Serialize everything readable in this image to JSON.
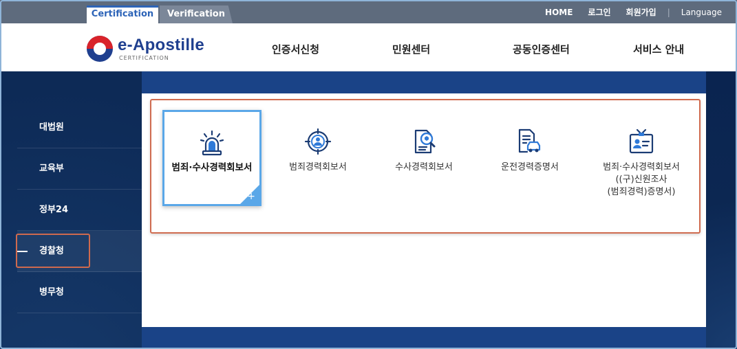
{
  "tabs": {
    "certification": "Certification",
    "verification": "Verification"
  },
  "top_links": {
    "home": "HOME",
    "login": "로그인",
    "signup": "회원가입",
    "separator": "|",
    "language": "Language"
  },
  "logo": {
    "name": "e-Apostille",
    "sub": "CERTIFICATION"
  },
  "nav": [
    {
      "label": "인증서신청"
    },
    {
      "label": "민원센터"
    },
    {
      "label": "공동인증센터"
    },
    {
      "label": "서비스 안내"
    }
  ],
  "sidebar": [
    {
      "label": "대법원"
    },
    {
      "label": "교육부"
    },
    {
      "label": "정부24"
    },
    {
      "label": "경찰청",
      "active": true
    },
    {
      "label": "병무청"
    }
  ],
  "cards": [
    {
      "label": "범죄·수사경력회보서",
      "icon": "siren-icon",
      "selected": true,
      "plus": "+"
    },
    {
      "label": "범죄경력회보서",
      "icon": "target-person-icon"
    },
    {
      "label": "수사경력회보서",
      "icon": "document-search-icon"
    },
    {
      "label": "운전경력증명서",
      "icon": "document-car-icon"
    },
    {
      "label_lines": [
        "범죄·수사경력회보서",
        "((구)신원조사",
        "(범죄경력)증명서)"
      ],
      "icon": "id-badge-icon"
    }
  ],
  "colors": {
    "accent": "#2d64b8",
    "navy": "#0a2450",
    "highlight": "#cf6b4f",
    "selected": "#5aa7e8"
  }
}
